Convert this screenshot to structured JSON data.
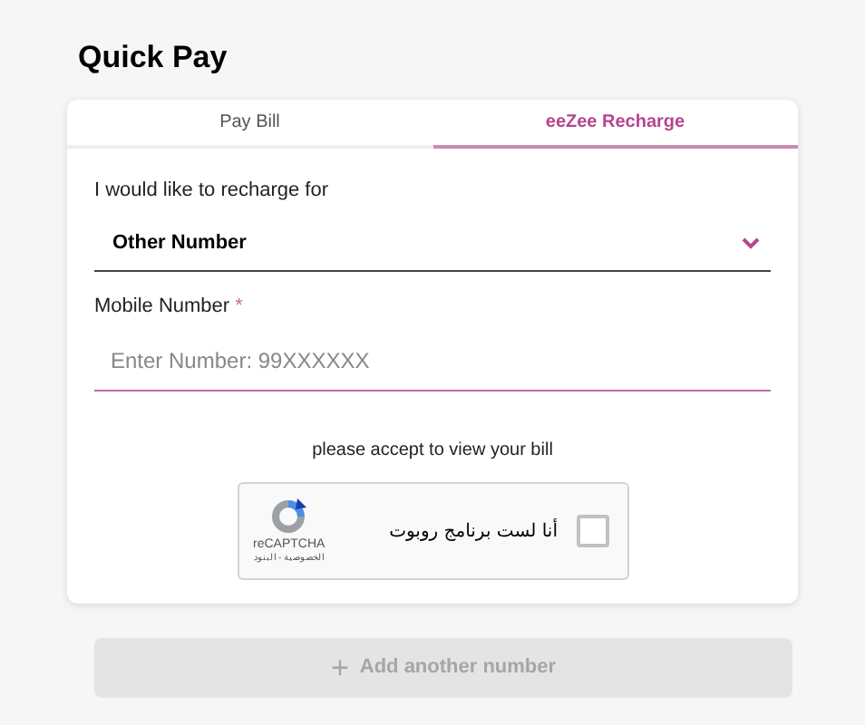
{
  "title": "Quick Pay",
  "tabs": [
    {
      "label": "Pay Bill",
      "selected": false
    },
    {
      "label": "eeZee Recharge",
      "selected": true
    }
  ],
  "recharge_for": {
    "label": "I would like to recharge for",
    "value": "Other Number"
  },
  "mobile_number": {
    "label": "Mobile Number",
    "required_mark": "*",
    "placeholder": "Enter Number: 99XXXXXX"
  },
  "captcha": {
    "prompt": "please accept to view your bill",
    "checkbox_label": "أنا لست برنامج روبوت",
    "checked": false,
    "brand": "reCAPTCHA",
    "links": "الخصوصية - البنود"
  },
  "add_button": {
    "icon": "+",
    "label": "Add another number",
    "disabled": true
  }
}
